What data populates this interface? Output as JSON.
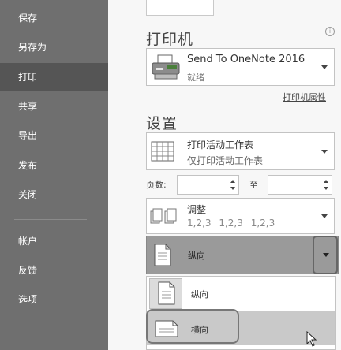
{
  "sidebar": {
    "items": [
      {
        "label": "保存"
      },
      {
        "label": "另存为"
      },
      {
        "label": "打印"
      },
      {
        "label": "共享"
      },
      {
        "label": "导出"
      },
      {
        "label": "发布"
      },
      {
        "label": "关闭"
      },
      {
        "label": "帐户"
      },
      {
        "label": "反馈"
      },
      {
        "label": "选项"
      }
    ],
    "active": "打印"
  },
  "printer": {
    "section_title": "打印机",
    "name": "Send To OneNote 2016",
    "status": "就绪",
    "properties_link": "打印机属性",
    "icon": "printer-icon"
  },
  "settings": {
    "section_title": "设置",
    "scope": {
      "title": "打印活动工作表",
      "subtitle": "仅打印活动工作表",
      "icon": "sheet-grid-icon"
    },
    "pages": {
      "label": "页数:",
      "to_label": "至",
      "from": "",
      "to": ""
    },
    "collate": {
      "title": "调整",
      "subtitle": "1,2,3   1,2,3   1,2,3",
      "icon": "collate-icon"
    },
    "orientation": {
      "selected": "纵向",
      "options": [
        {
          "label": "纵向",
          "icon": "portrait-page-icon"
        },
        {
          "label": "横向",
          "icon": "landscape-page-icon"
        }
      ],
      "hovered": "横向"
    }
  },
  "colors": {
    "sidebar": "#6f6f6f",
    "sidebar_active": "#555555",
    "selected_dropdown": "#9a9a9a",
    "hover_item": "#c9c9c9"
  }
}
